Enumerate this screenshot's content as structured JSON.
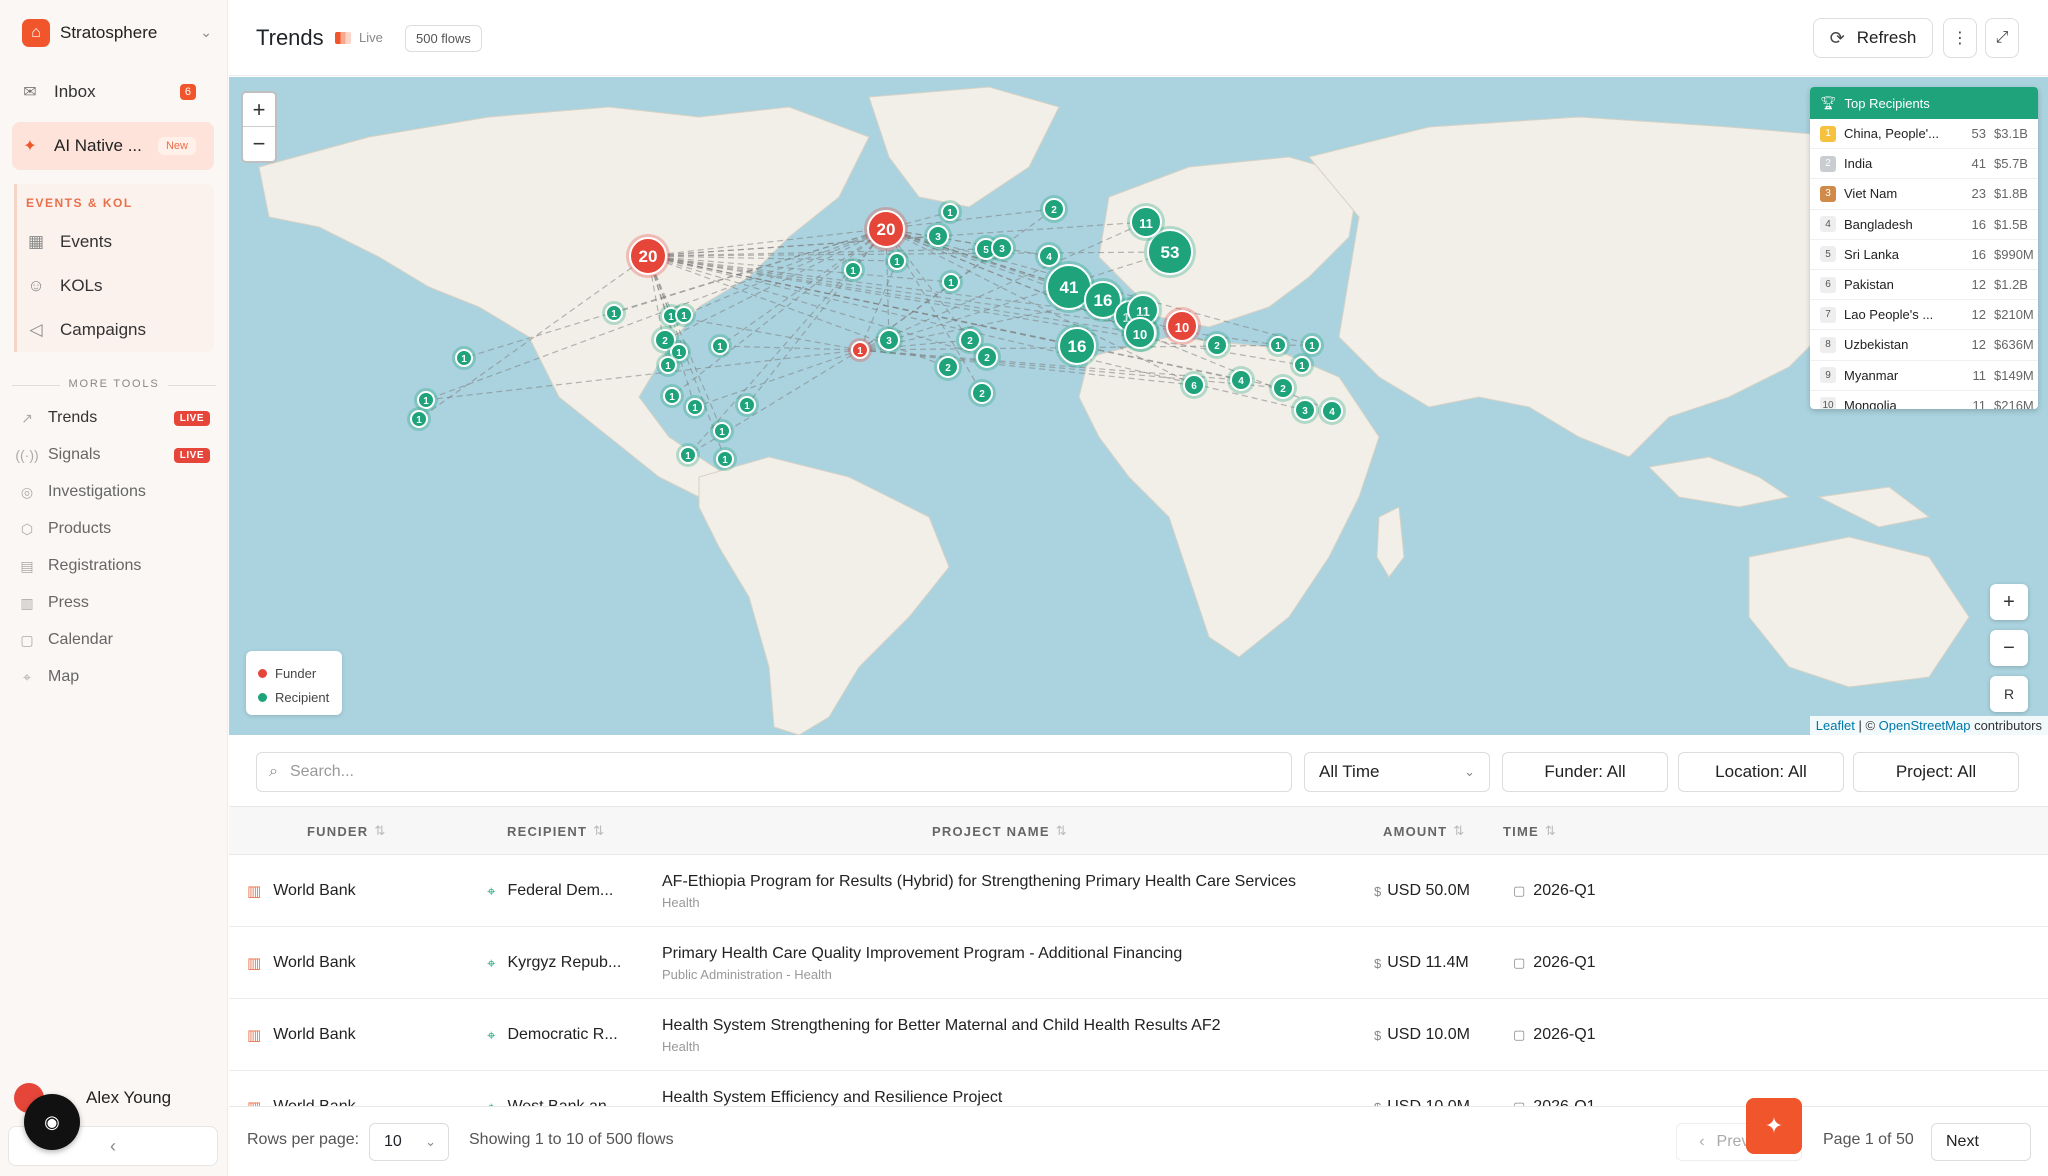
{
  "sidebar": {
    "brand": "Stratosphere",
    "inbox": {
      "label": "Inbox",
      "count": "6"
    },
    "ai_native": {
      "label": "AI Native ...",
      "badge": "New"
    },
    "events_kol": {
      "heading": "EVENTS & KOL",
      "items": [
        "Events",
        "KOLs",
        "Campaigns"
      ]
    },
    "more_tools": {
      "heading": "MORE TOOLS",
      "items": [
        {
          "label": "Trends",
          "badge": "LIVE"
        },
        {
          "label": "Signals",
          "badge": "LIVE"
        },
        {
          "label": "Investigations"
        },
        {
          "label": "Products"
        },
        {
          "label": "Registrations"
        },
        {
          "label": "Press"
        },
        {
          "label": "Calendar"
        },
        {
          "label": "Map"
        }
      ]
    },
    "user": "Alex Young"
  },
  "header": {
    "title": "Trends",
    "live": "Live",
    "flows": "500 flows",
    "refresh": "Refresh"
  },
  "map": {
    "legend": {
      "funder": "Funder",
      "recipient": "Recipient"
    },
    "attribution": {
      "leaflet": "Leaflet",
      "sep": "| ©",
      "osm": "OpenStreetMap",
      "tail": "contributors"
    },
    "zoom_in": "+",
    "zoom_out": "−",
    "reset": "R",
    "colors": {
      "funder": "#e6463a",
      "recipient": "#1ea37a",
      "water": "#aad3df",
      "land": "#f2efe9"
    },
    "top_recipients": {
      "title": "Top Recipients",
      "rows": [
        {
          "rank": "1",
          "name": "China, People'...",
          "count": "53",
          "amount": "$3.1B"
        },
        {
          "rank": "2",
          "name": "India",
          "count": "41",
          "amount": "$5.7B"
        },
        {
          "rank": "3",
          "name": "Viet Nam",
          "count": "23",
          "amount": "$1.8B"
        },
        {
          "rank": "4",
          "name": "Bangladesh",
          "count": "16",
          "amount": "$1.5B"
        },
        {
          "rank": "5",
          "name": "Sri Lanka",
          "count": "16",
          "amount": "$990M"
        },
        {
          "rank": "6",
          "name": "Pakistan",
          "count": "12",
          "amount": "$1.2B"
        },
        {
          "rank": "7",
          "name": "Lao People's ...",
          "count": "12",
          "amount": "$210M"
        },
        {
          "rank": "8",
          "name": "Uzbekistan",
          "count": "12",
          "amount": "$636M"
        },
        {
          "rank": "9",
          "name": "Myanmar",
          "count": "11",
          "amount": "$149M"
        },
        {
          "rank": "10",
          "name": "Mongolia",
          "count": "11",
          "amount": "$216M"
        }
      ]
    },
    "funder_clusters": [
      "20",
      "20",
      "1",
      "10"
    ],
    "recipient_clusters": [
      "53",
      "41",
      "16",
      "16",
      "13",
      "12",
      "11",
      "11",
      "10",
      "6",
      "5",
      "4",
      "4",
      "4",
      "3",
      "3",
      "3",
      "3",
      "2",
      "2",
      "2",
      "2",
      "2",
      "2",
      "2",
      "2",
      "1",
      "1",
      "1",
      "1",
      "1",
      "1",
      "1",
      "1",
      "1",
      "1",
      "1",
      "1",
      "1",
      "1",
      "1",
      "1",
      "1",
      "1",
      "1",
      "1",
      "1",
      "1"
    ]
  },
  "filters": {
    "search_placeholder": "Search...",
    "time": "All Time",
    "funder": "Funder: All",
    "location": "Location: All",
    "project": "Project: All"
  },
  "table": {
    "columns": [
      "FUNDER",
      "RECIPIENT",
      "PROJECT NAME",
      "AMOUNT",
      "TIME"
    ],
    "rows": [
      {
        "funder": "World Bank",
        "recipient": "Federal Dem...",
        "project": "AF-Ethiopia Program for Results (Hybrid) for Strengthening Primary Health Care Services",
        "sector": "Health",
        "amount": "USD 50.0M",
        "time": "2026-Q1"
      },
      {
        "funder": "World Bank",
        "recipient": "Kyrgyz Repub...",
        "project": "Primary Health Care Quality Improvement Program - Additional Financing",
        "sector": "Public Administration - Health",
        "amount": "USD 11.4M",
        "time": "2026-Q1"
      },
      {
        "funder": "World Bank",
        "recipient": "Democratic R...",
        "project": "Health System Strengthening for Better Maternal and Child Health Results AF2",
        "sector": "Health",
        "amount": "USD 10.0M",
        "time": "2026-Q1"
      },
      {
        "funder": "World Bank",
        "recipient": "West Bank an...",
        "project": "Health System Efficiency and Resilience Project",
        "sector": "Health",
        "amount": "USD 10.0M",
        "time": "2026-Q1"
      }
    ]
  },
  "footer": {
    "rows_label": "Rows per page:",
    "rows_value": "10",
    "showing": "Showing 1 to 10 of 500 flows",
    "previous": "Previous",
    "page": "Page 1 of 50",
    "next": "Next"
  }
}
